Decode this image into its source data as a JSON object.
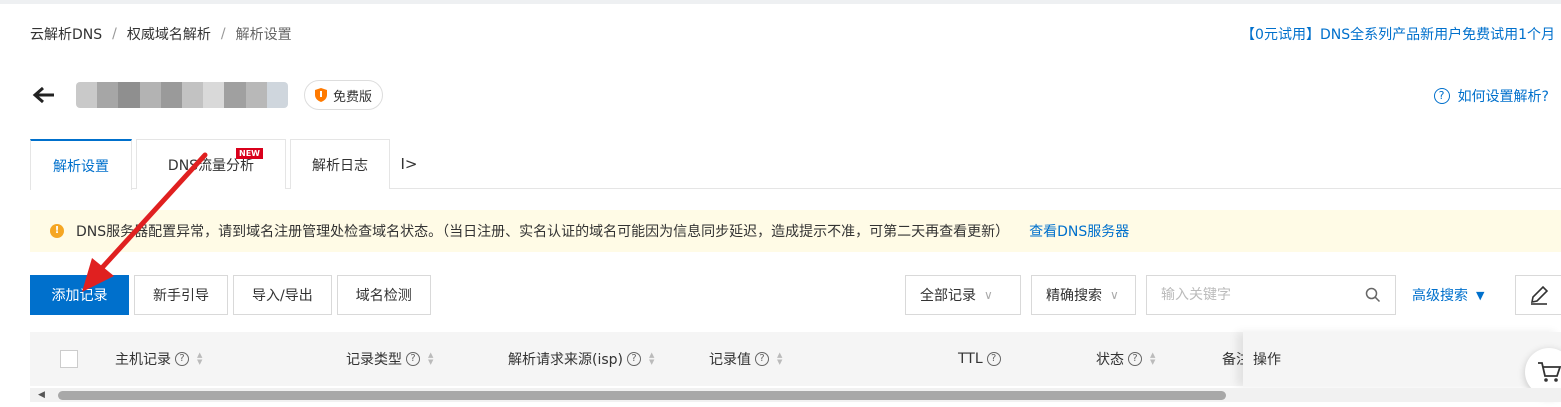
{
  "breadcrumb": {
    "item1": "云解析DNS",
    "item2": "权威域名解析",
    "current": "解析设置",
    "separator": "/"
  },
  "promo": "【0元试用】DNS全系列产品新用户免费试用1个月",
  "domain": {
    "badge_label": "免费版"
  },
  "help_link": "如何设置解析?",
  "tabs": [
    {
      "label": "解析设置",
      "active": true
    },
    {
      "label": "DNS流量分析",
      "badge": "NEW"
    },
    {
      "label": "解析日志"
    }
  ],
  "tab_more": "I>",
  "alert": {
    "text": "DNS服务器配置异常，请到域名注册管理处检查域名状态。（当日注册、实名认证的域名可能因为信息同步延迟，造成提示不准，可第二天再查看更新）",
    "link": "查看DNS服务器"
  },
  "toolbar": {
    "add_record": "添加记录",
    "guide": "新手引导",
    "import_export": "导入/导出",
    "domain_check": "域名检测"
  },
  "filters": {
    "record_filter": "全部记录",
    "search_mode": "精确搜索",
    "search_placeholder": "输入关键字",
    "advanced": "高级搜索"
  },
  "table": {
    "headers": {
      "host": "主机记录",
      "type": "记录类型",
      "isp": "解析请求来源(isp)",
      "value": "记录值",
      "ttl": "TTL",
      "status": "状态",
      "remark": "备注",
      "actions": "操作"
    }
  },
  "colors": {
    "accent": "#0070cc",
    "alert_bg": "#fffbe6",
    "warning": "#f5a623",
    "annotation_arrow": "#e02020"
  }
}
